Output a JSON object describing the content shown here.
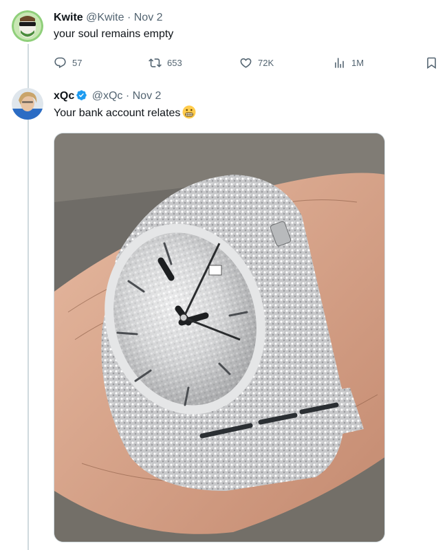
{
  "tweets": [
    {
      "name": "Kwite",
      "handle": "@Kwite",
      "sep": "·",
      "date": "Nov 2",
      "text": "your soul remains empty",
      "actions": {
        "reply": "57",
        "retweet": "653",
        "like": "72K",
        "views": "1M"
      }
    },
    {
      "name": "xQc",
      "handle": "@xQc",
      "sep": "·",
      "date": "Nov 2",
      "text": "Your bank account relates",
      "emoji": "grimacing-face",
      "verified": true,
      "media": "photo of an iced-out diamond wristwatch on a wrist"
    }
  ],
  "colors": {
    "accent": "#1d9bf0",
    "muted": "#536471",
    "line": "#cfd9de"
  }
}
